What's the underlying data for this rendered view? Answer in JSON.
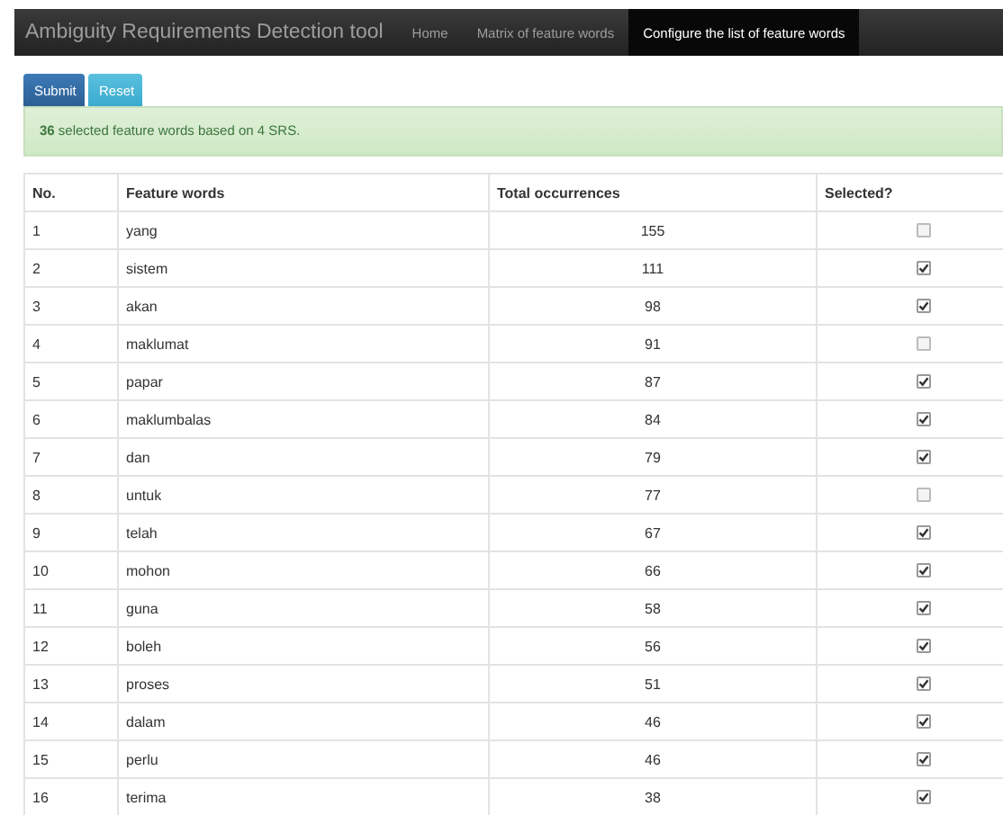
{
  "navbar": {
    "brand": "Ambiguity Requirements Detection tool",
    "links": [
      {
        "label": "Home",
        "selected": false
      },
      {
        "label": "Matrix of feature words",
        "selected": false
      },
      {
        "label": "Configure the list of feature words",
        "selected": true
      }
    ]
  },
  "buttons": [
    {
      "label": "Submit",
      "kind": "primary"
    },
    {
      "label": "Reset",
      "kind": "info"
    }
  ],
  "alert": "**36** selected feature words based on 4 SRS.",
  "table": {
    "columns": [
      "No.",
      "Feature words",
      "Total occurrences",
      "Selected?"
    ],
    "rows": [
      {
        "no": "1",
        "word": "yang",
        "total": "155",
        "checked": false
      },
      {
        "no": "2",
        "word": "sistem",
        "total": "111",
        "checked": true
      },
      {
        "no": "3",
        "word": "akan",
        "total": "98",
        "checked": true
      },
      {
        "no": "4",
        "word": "maklumat",
        "total": "91",
        "checked": false
      },
      {
        "no": "5",
        "word": "papar",
        "total": "87",
        "checked": true
      },
      {
        "no": "6",
        "word": "maklumbalas",
        "total": "84",
        "checked": true
      },
      {
        "no": "7",
        "word": "dan",
        "total": "79",
        "checked": true
      },
      {
        "no": "8",
        "word": "untuk",
        "total": "77",
        "checked": false
      },
      {
        "no": "9",
        "word": "telah",
        "total": "67",
        "checked": true
      },
      {
        "no": "10",
        "word": "mohon",
        "total": "66",
        "checked": true
      },
      {
        "no": "11",
        "word": "guna",
        "total": "58",
        "checked": true
      },
      {
        "no": "12",
        "word": "boleh",
        "total": "56",
        "checked": true
      },
      {
        "no": "13",
        "word": "proses",
        "total": "51",
        "checked": true
      },
      {
        "no": "14",
        "word": "dalam",
        "total": "46",
        "checked": true
      },
      {
        "no": "15",
        "word": "perlu",
        "total": "46",
        "checked": true
      },
      {
        "no": "16",
        "word": "terima",
        "total": "38",
        "checked": true
      }
    ]
  }
}
